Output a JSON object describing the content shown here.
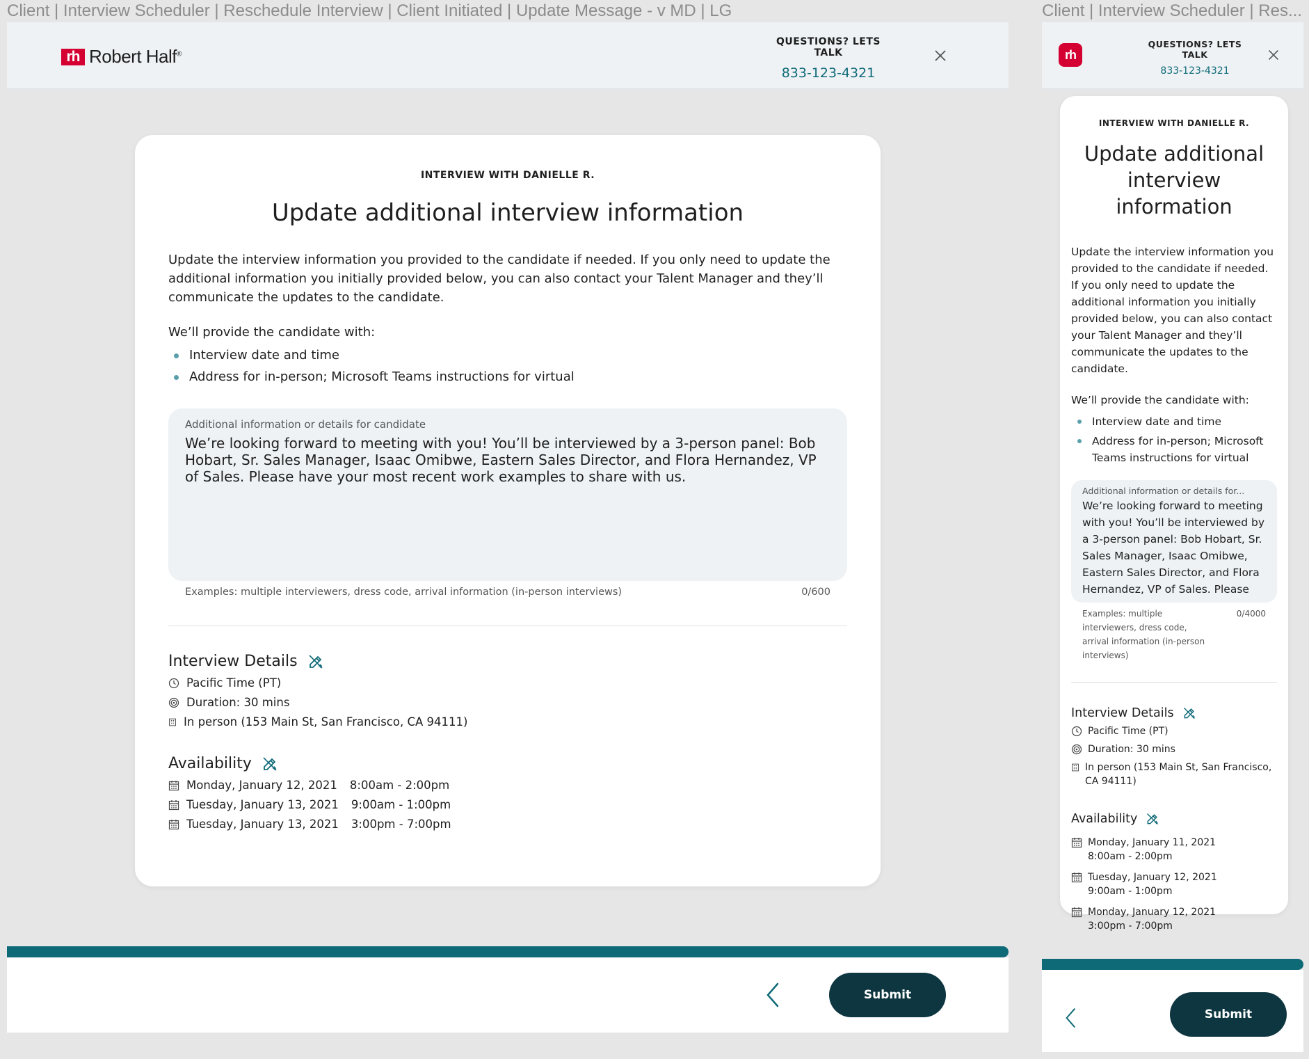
{
  "frames": {
    "lg": {
      "title": "Client | Interview Scheduler | Reschedule Interview | Client Initiated | Update Message - v MD | LG"
    },
    "md": {
      "title": "Client | Interview Scheduler | Res..."
    }
  },
  "brand": {
    "name": "Robert Half",
    "mark": "rh",
    "trademark": "®",
    "color": "#d50032"
  },
  "header": {
    "contact_label": "QUESTIONS? LETS TALK",
    "phone": "833-123-4321",
    "close_icon": "close-icon"
  },
  "card": {
    "eyebrow": "INTERVIEW WITH DANIELLE R.",
    "title": "Update additional interview information",
    "intro": "Update the interview information you provided to the candidate if needed. If you only need to update the additional information you initially provided below, you can also contact your Talent Manager and they’ll communicate the updates to the candidate.",
    "provide_label": "We’ll provide the candidate with:",
    "bullets": [
      "Interview date and time",
      "Address for in-person; Microsoft Teams instructions for virtual"
    ],
    "textarea": {
      "label": "Additional information or details for candidate",
      "label_truncated": "Additional information or details for...",
      "value": "We’re looking forward to meeting with you! You’ll be interviewed by a 3-person panel: Bob Hobart, Sr. Sales Manager, Isaac Omibwe, Eastern Sales Director, and Flora Hernandez, VP of Sales. Please have your most recent work examples to share with us.",
      "value_visible_md": "We’re looking forward to meeting with you! You’ll be interviewed by a 3-person panel: Bob Hobart, Sr. Sales Manager, Isaac Omibwe, Eastern Sales Director, and Flora Hernandez, VP of Sales. Please",
      "helper": "Examples: multiple interviewers, dress code, arrival information (in-person interviews)",
      "counter_lg": "0/600",
      "counter_md": "0/4000"
    },
    "interview_details": {
      "heading": "Interview Details",
      "timezone": "Pacific Time (PT)",
      "duration": "Duration: 30 mins",
      "location": "In person (153 Main St, San Francisco, CA 94111)"
    },
    "availability": {
      "heading": "Availability",
      "slots_lg": [
        {
          "date": "Monday, January 12, 2021",
          "time": "8:00am - 2:00pm"
        },
        {
          "date": "Tuesday, January 13, 2021",
          "time": "9:00am - 1:00pm"
        },
        {
          "date": "Tuesday, January 13, 2021",
          "time": "3:00pm - 7:00pm"
        }
      ],
      "slots_md": [
        {
          "date": "Monday, January 11, 2021",
          "time": "8:00am - 2:00pm"
        },
        {
          "date": "Tuesday, January 12, 2021",
          "time": "9:00am - 1:00pm"
        },
        {
          "date": "Monday, January 12, 2021",
          "time": "3:00pm - 7:00pm"
        }
      ]
    }
  },
  "footer": {
    "submit_label": "Submit",
    "back_icon": "chevron-left-icon",
    "progress_percent": 100
  },
  "colors": {
    "accent": "#0f6a78",
    "button": "#0e3640",
    "panel": "#eef2f5",
    "background": "#e6e6e6"
  }
}
